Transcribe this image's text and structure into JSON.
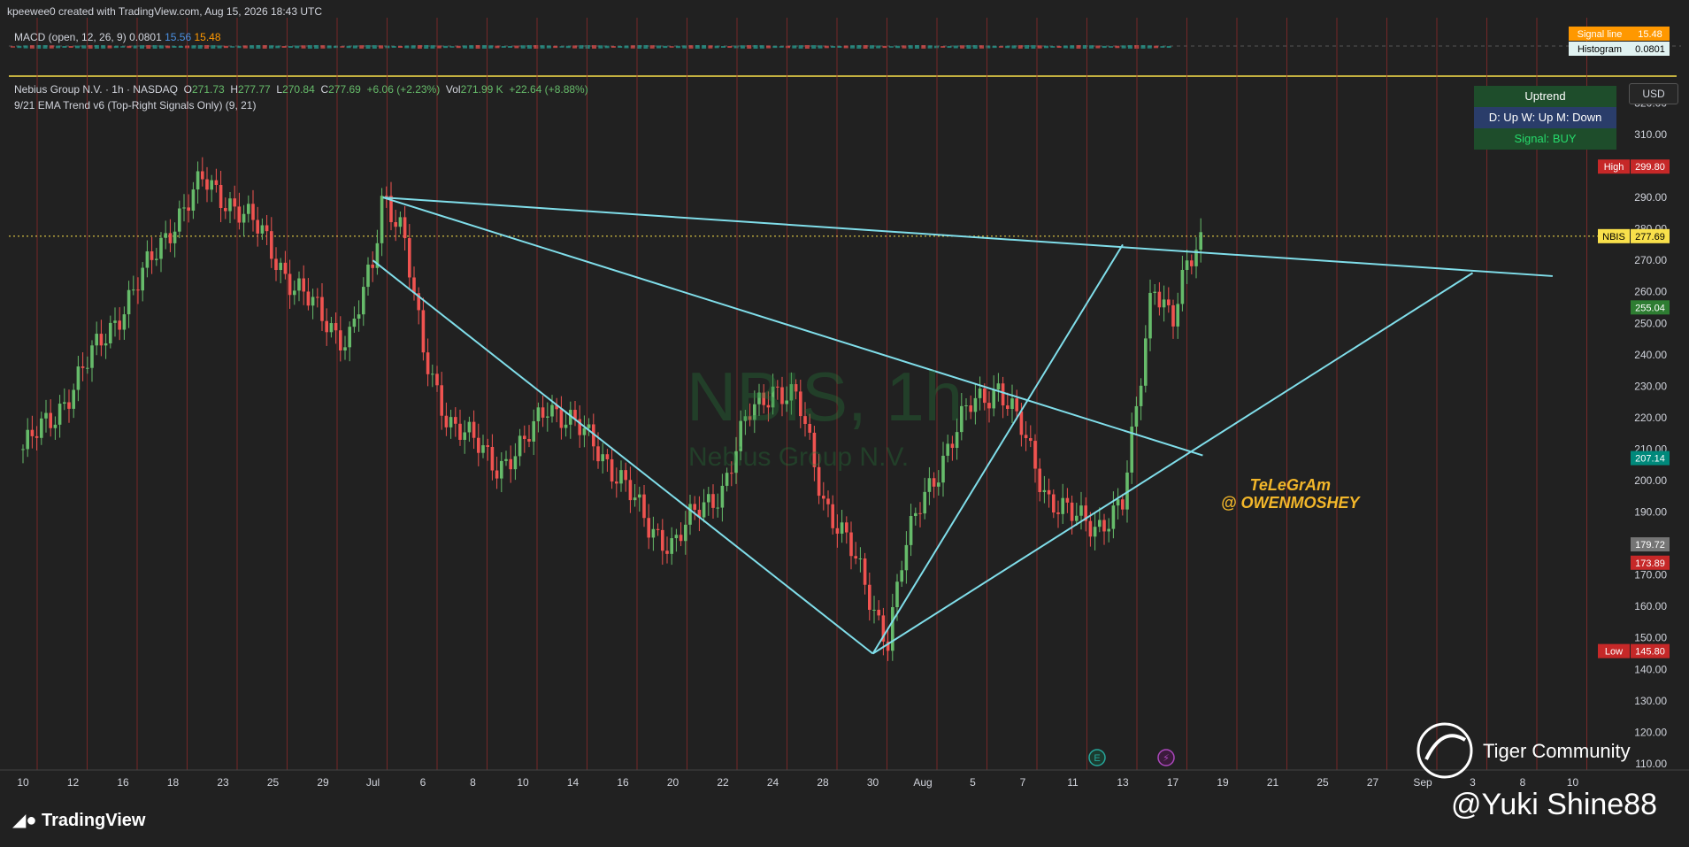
{
  "header": {
    "credit": "kpeewee0 created with TradingView.com, Aug 15, 2026 18:43 UTC"
  },
  "macd": {
    "label": "MACD (open, 12, 26, 9)",
    "hist": "0.0801",
    "macd": "15.56",
    "signal": "15.48",
    "signal_label": "Signal line",
    "histogram_label": "Histogram"
  },
  "symbol": {
    "name": "Nebius Group N.V. · 1h · NASDAQ",
    "o": "271.73",
    "h": "277.77",
    "l": "270.84",
    "c": "277.69",
    "change": "+6.06 (+2.23%)",
    "vol": "271.99 K",
    "vol_change": "+22.64 (+8.88%)",
    "ticker": "NBIS"
  },
  "indicator": {
    "label": "9/21 EMA Trend v6 (Top-Right Signals Only) (9, 21)"
  },
  "trend_panel": {
    "title": "Uptrend",
    "timeframes": "D: Up    W: Up    M: Down",
    "signal": "Signal: BUY"
  },
  "currency": "USD",
  "watermark": {
    "main": "NBIS, 1h",
    "sub": "Nebius Group N.V."
  },
  "annotation": {
    "line1": "TeLeGrAm",
    "line2": "@ OWENMOSHEY"
  },
  "branding": {
    "tradingview": "TradingView",
    "tiger": "Tiger Community",
    "author": "@Yuki Shine88"
  },
  "colors": {
    "background": "#212121",
    "up": "#66bb6a",
    "down": "#ef5350",
    "trendline": "#80deea",
    "vline": "#8b2a2a"
  },
  "chart_data": {
    "type": "candlestick",
    "title": "NBIS, 1h",
    "x_tick_labels": [
      "10",
      "12",
      "16",
      "18",
      "23",
      "25",
      "29",
      "Jul",
      "6",
      "8",
      "10",
      "14",
      "16",
      "20",
      "22",
      "24",
      "28",
      "30",
      "Aug",
      "5",
      "7",
      "11",
      "13",
      "17",
      "19",
      "21",
      "25",
      "27",
      "Sep",
      "3",
      "8",
      "10"
    ],
    "y_ticks": [
      110,
      120,
      130,
      140,
      150,
      160,
      170,
      180,
      190,
      200,
      210,
      220,
      230,
      240,
      250,
      260,
      270,
      280,
      290,
      300,
      310,
      320
    ],
    "ylim": [
      108,
      328
    ],
    "price_labels": [
      {
        "label": "High",
        "value": 299.8,
        "color": "#c62828"
      },
      {
        "label": "NBIS",
        "value": 277.69,
        "color": "#f9e04b"
      },
      {
        "label": "",
        "value": 255.04,
        "color": "#2e7d32"
      },
      {
        "label": "",
        "value": 207.14,
        "color": "#00897b"
      },
      {
        "label": "",
        "value": 179.72,
        "color": "#757575"
      },
      {
        "label": "",
        "value": 173.89,
        "color": "#c62828"
      },
      {
        "label": "Low",
        "value": 145.8,
        "color": "#c62828"
      }
    ],
    "current_price": 277.69,
    "price_path": [
      [
        0,
        210
      ],
      [
        0.6,
        220
      ],
      [
        1.2,
        235
      ],
      [
        1.8,
        250
      ],
      [
        2.4,
        265
      ],
      [
        3.0,
        282
      ],
      [
        3.6,
        295
      ],
      [
        4.2,
        288
      ],
      [
        4.8,
        278
      ],
      [
        5.4,
        262
      ],
      [
        6.0,
        252
      ],
      [
        6.5,
        244
      ],
      [
        7.0,
        268
      ],
      [
        7.2,
        292
      ],
      [
        7.6,
        280
      ],
      [
        8.0,
        240
      ],
      [
        8.5,
        220
      ],
      [
        9.0,
        212
      ],
      [
        9.5,
        205
      ],
      [
        10.0,
        210
      ],
      [
        10.5,
        225
      ],
      [
        11.0,
        218
      ],
      [
        11.5,
        210
      ],
      [
        12.0,
        200
      ],
      [
        12.5,
        185
      ],
      [
        13.0,
        180
      ],
      [
        13.5,
        190
      ],
      [
        14.0,
        198
      ],
      [
        14.5,
        220
      ],
      [
        15.0,
        230
      ],
      [
        15.5,
        225
      ],
      [
        16.0,
        195
      ],
      [
        16.5,
        180
      ],
      [
        17.0,
        160
      ],
      [
        17.3,
        150
      ],
      [
        17.6,
        175
      ],
      [
        18.0,
        195
      ],
      [
        18.5,
        210
      ],
      [
        19.0,
        225
      ],
      [
        19.5,
        230
      ],
      [
        20.0,
        215
      ],
      [
        20.5,
        195
      ],
      [
        21.0,
        188
      ],
      [
        21.5,
        186
      ],
      [
        22.0,
        192
      ],
      [
        22.3,
        225
      ],
      [
        22.6,
        265
      ],
      [
        23.0,
        250
      ],
      [
        23.3,
        268
      ],
      [
        23.6,
        278
      ]
    ],
    "trendlines": [
      {
        "from": [
          7.2,
          290
        ],
        "to": [
          30.6,
          265
        ]
      },
      {
        "from": [
          7.2,
          290
        ],
        "to": [
          23.6,
          208
        ]
      },
      {
        "from": [
          7.0,
          270
        ],
        "to": [
          17.0,
          145
        ]
      },
      {
        "from": [
          17.0,
          145
        ],
        "to": [
          22.0,
          275
        ]
      },
      {
        "from": [
          17.0,
          145
        ],
        "to": [
          29.0,
          266
        ]
      }
    ]
  }
}
